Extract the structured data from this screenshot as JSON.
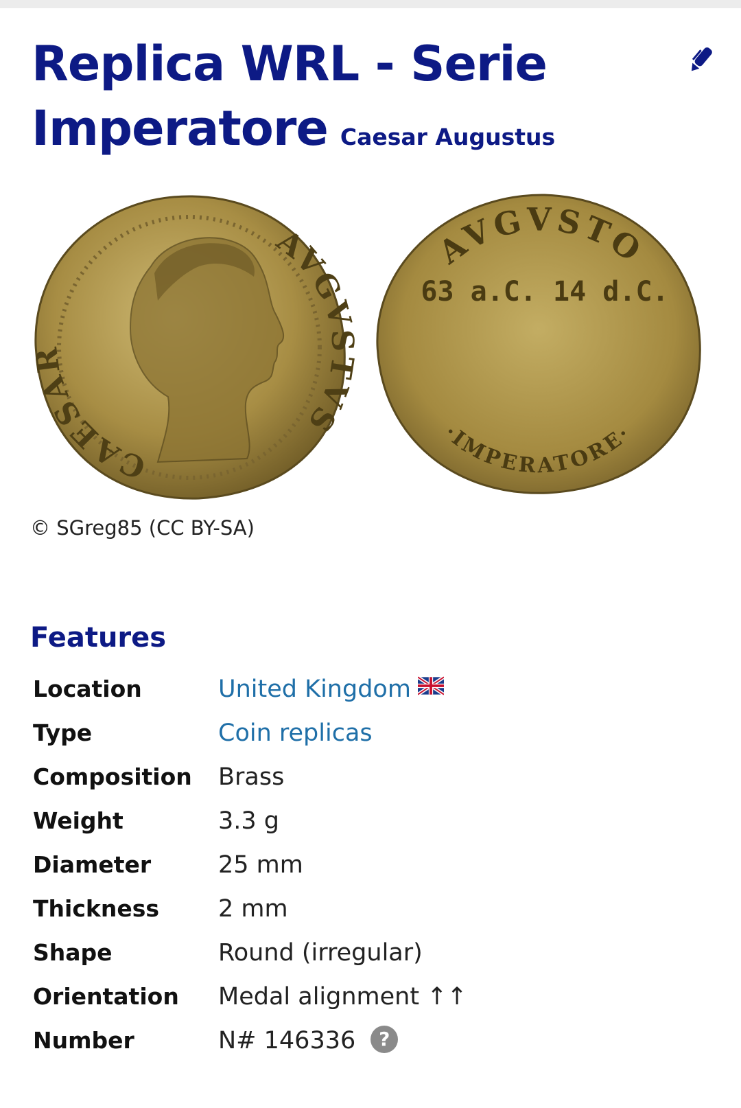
{
  "title": {
    "line1": "Replica WRL - Serie",
    "line2": "Imperatore",
    "subtitle": "Caesar Augustus"
  },
  "edit_icon": "pencil-icon",
  "images": {
    "obverse": {
      "legend_left": "CAESAR",
      "legend_right": "AVGVSTVS"
    },
    "reverse": {
      "legend_top": "AVGVSTO",
      "dates": "63 a.C. 14 d.C.",
      "legend_bottom": "·IMPERATORE·"
    },
    "copyright": "© SGreg85 (CC BY-SA)"
  },
  "features": {
    "heading": "Features",
    "rows": [
      {
        "label": "Location",
        "value": "United Kingdom"
      },
      {
        "label": "Type",
        "value": "Coin replicas"
      },
      {
        "label": "Composition",
        "value": "Brass"
      },
      {
        "label": "Weight",
        "value": "3.3 g"
      },
      {
        "label": "Diameter",
        "value": "25 mm"
      },
      {
        "label": "Thickness",
        "value": "2 mm"
      },
      {
        "label": "Shape",
        "value": "Round (irregular)"
      },
      {
        "label": "Orientation",
        "value": "Medal alignment ↑↑"
      },
      {
        "label": "Number",
        "value": "N# 146336"
      }
    ],
    "help_icon": "help-icon",
    "flag_icon": "uk-flag-icon"
  },
  "colors": {
    "title": "#0d1a85",
    "link": "#1f6fa8",
    "coin_gold": "#b59a48"
  }
}
